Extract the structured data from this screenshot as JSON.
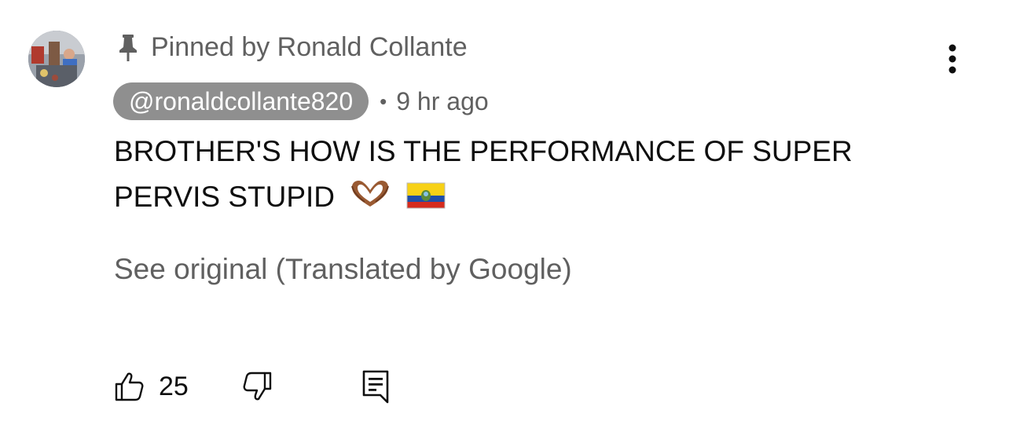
{
  "comment": {
    "pinned_text": "Pinned by Ronald Collante",
    "author_handle": "@ronaldcollante820",
    "separator": "•",
    "time_ago": "9 hr ago",
    "body_text": "BROTHER'S HOW IS THE PERFORMANCE OF SUPER PERVIS STUPID",
    "emoji_icons": [
      "heart-hands-icon",
      "ecuador-flag-icon"
    ],
    "see_original_label": "See original (Translated by Google)",
    "like_count": "25",
    "icons": {
      "avatar": "avatar",
      "pin": "pin-icon",
      "more": "more-vertical-icon",
      "like": "thumbs-up-icon",
      "dislike": "thumbs-down-icon",
      "reply": "reply-icon"
    }
  },
  "colors": {
    "handle_chip_bg": "#8f8f8f",
    "secondary_text": "#606060",
    "primary_text": "#0f0f0f"
  }
}
